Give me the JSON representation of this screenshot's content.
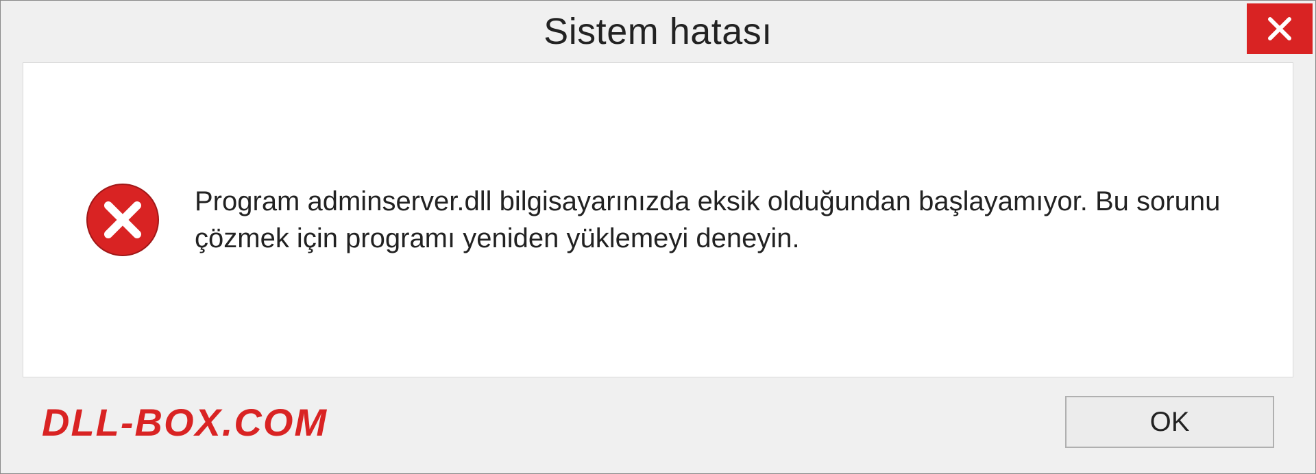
{
  "titlebar": {
    "title": "Sistem hatası"
  },
  "content": {
    "message": "Program adminserver.dll bilgisayarınızda eksik olduğundan başlayamıyor. Bu sorunu çözmek için programı yeniden yüklemeyi deneyin."
  },
  "footer": {
    "watermark": "DLL-BOX.COM",
    "ok_label": "OK"
  }
}
